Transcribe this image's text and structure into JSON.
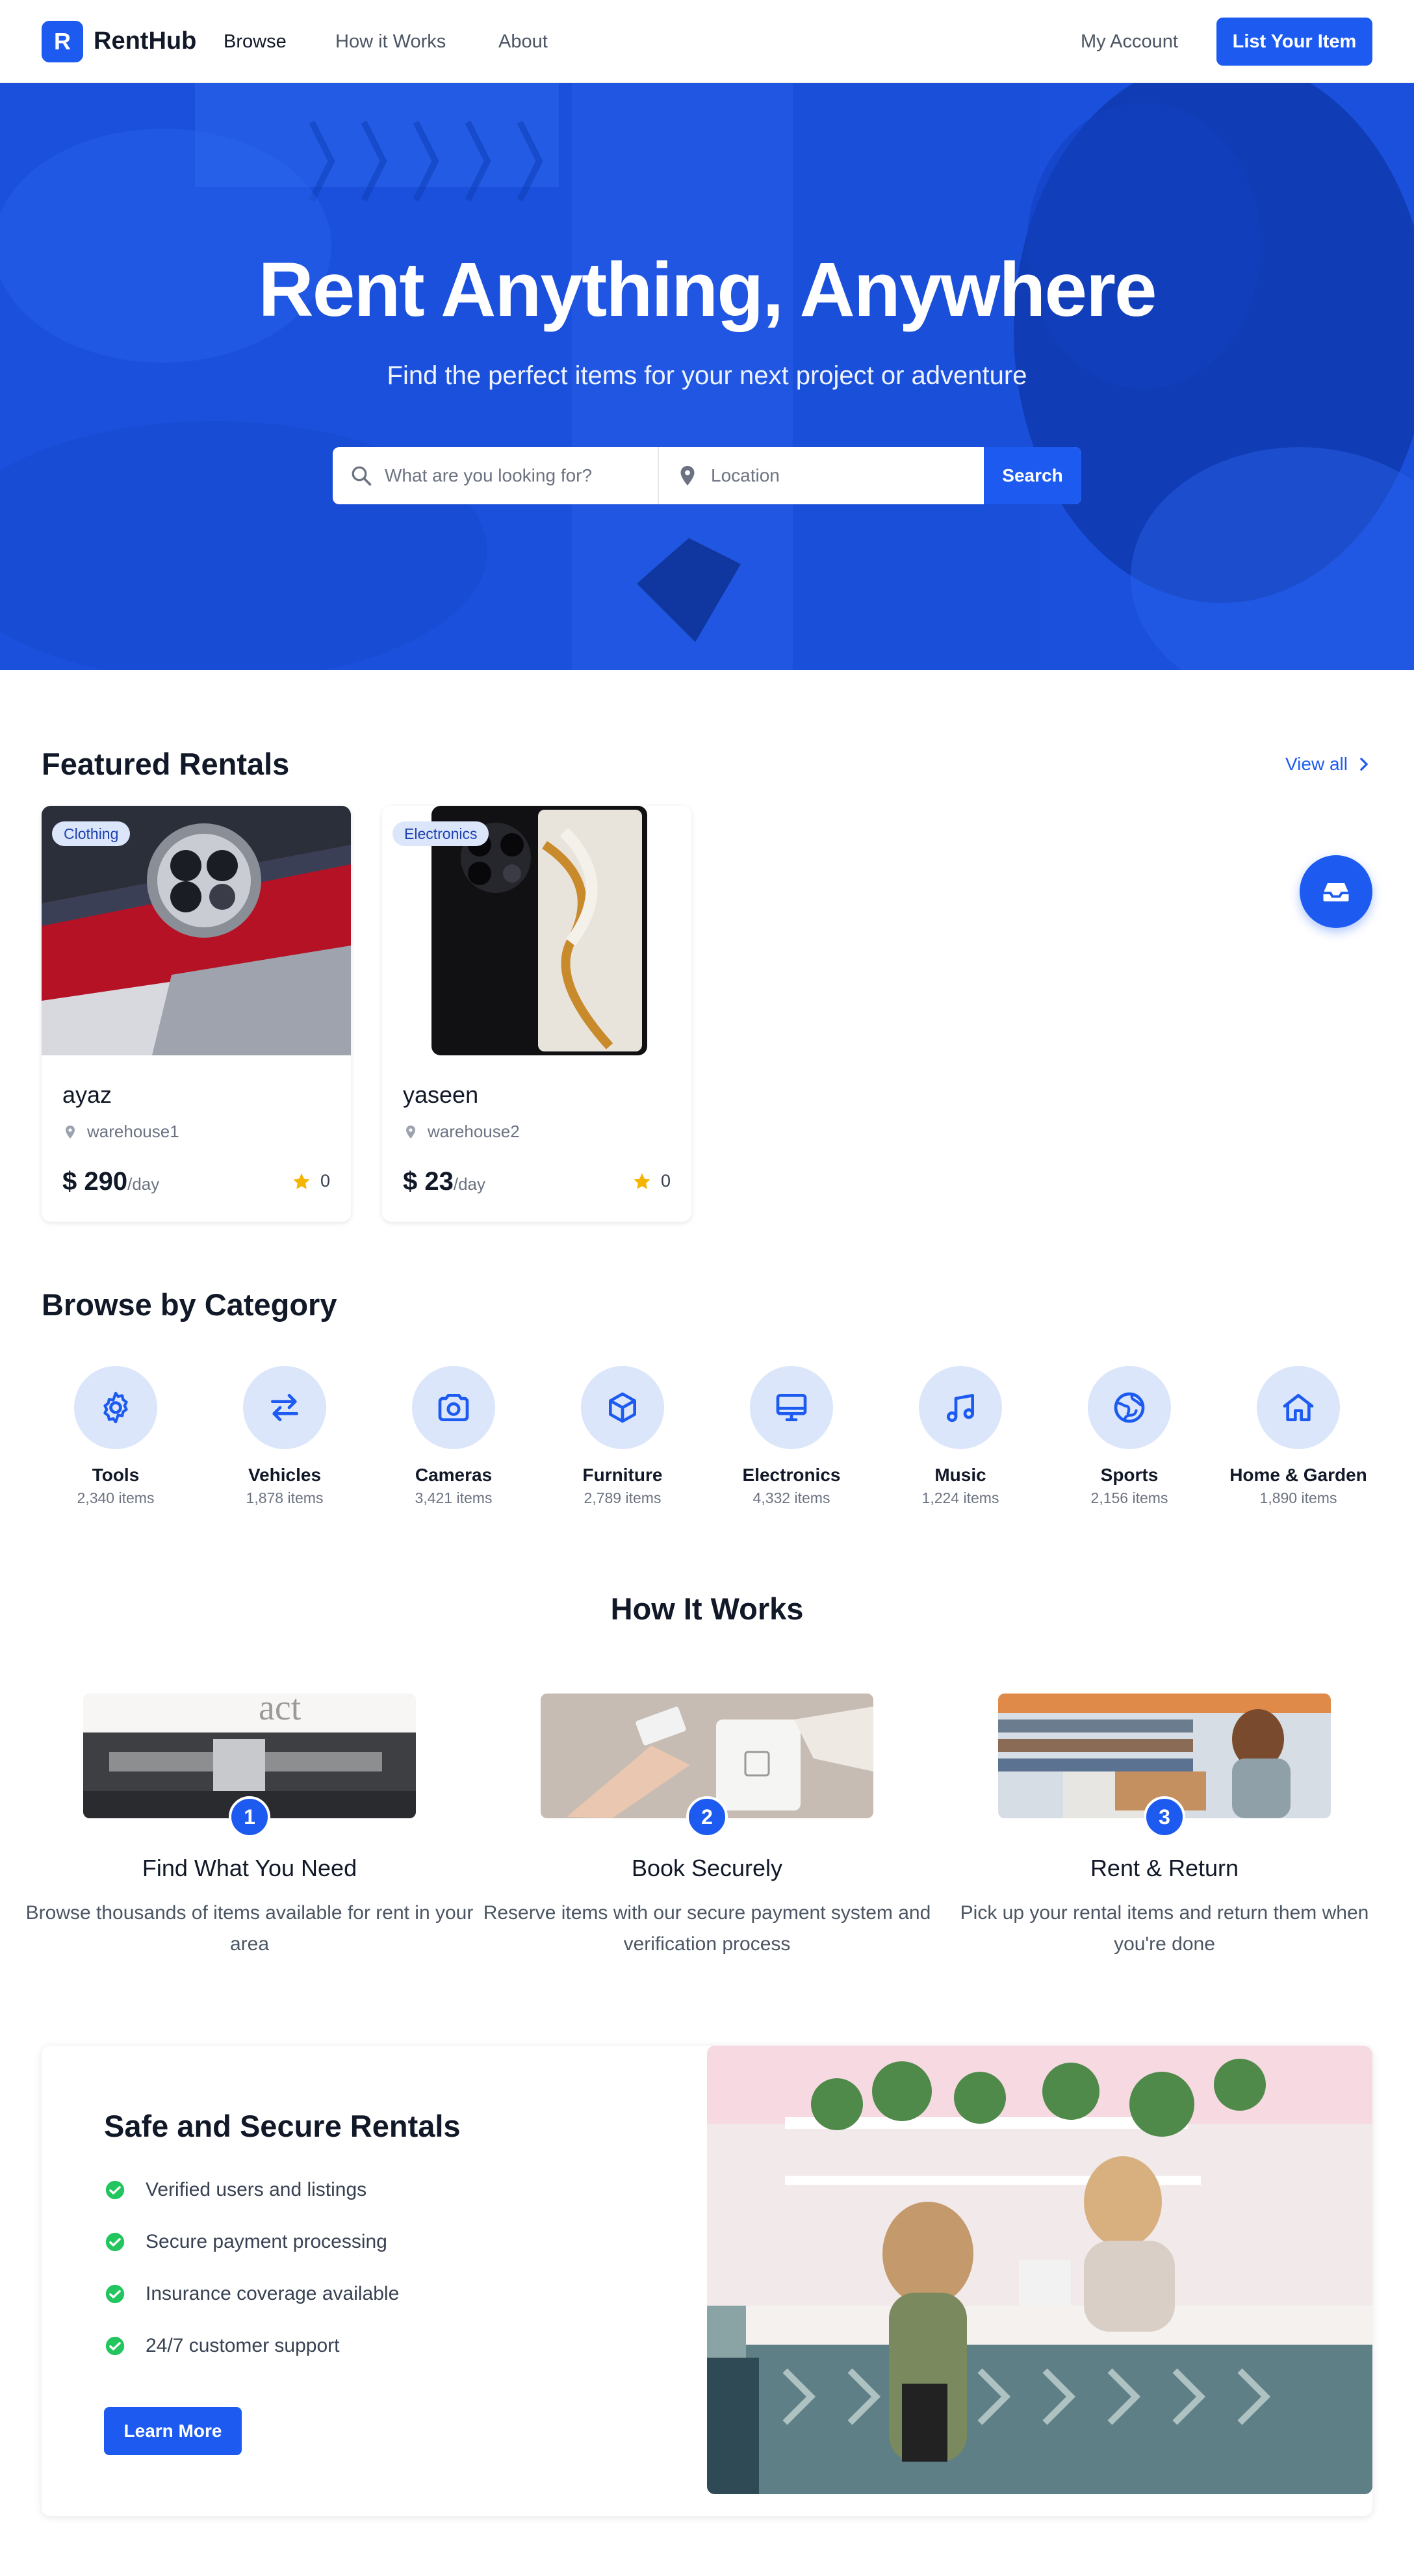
{
  "nav": {
    "logo_letter": "R",
    "brand": "RentHub",
    "links": [
      "Browse",
      "How it Works",
      "About"
    ],
    "account": "My Account",
    "cta": "List Your Item"
  },
  "hero": {
    "title": "Rent Anything, Anywhere",
    "subtitle": "Find the perfect items for your next project or adventure",
    "search_placeholder": "What are you looking for?",
    "location_placeholder": "Location",
    "search_button": "Search"
  },
  "featured": {
    "title": "Featured Rentals",
    "view_all": "View all",
    "items": [
      {
        "badge": "Clothing",
        "name": "ayaz",
        "location": "warehouse1",
        "currency": "$",
        "price": "290",
        "unit": "/day",
        "rating": "0"
      },
      {
        "badge": "Electronics",
        "name": "yaseen",
        "location": "warehouse2",
        "currency": "$",
        "price": "23",
        "unit": "/day",
        "rating": "0"
      }
    ]
  },
  "categories": {
    "title": "Browse by Category",
    "items": [
      {
        "name": "Tools",
        "count": "2,340 items",
        "icon": "gear-icon"
      },
      {
        "name": "Vehicles",
        "count": "1,878 items",
        "icon": "swap-arrows-icon"
      },
      {
        "name": "Cameras",
        "count": "3,421 items",
        "icon": "camera-icon"
      },
      {
        "name": "Furniture",
        "count": "2,789 items",
        "icon": "box-icon"
      },
      {
        "name": "Electronics",
        "count": "4,332 items",
        "icon": "monitor-icon"
      },
      {
        "name": "Music",
        "count": "1,224 items",
        "icon": "music-note-icon"
      },
      {
        "name": "Sports",
        "count": "2,156 items",
        "icon": "globe-ball-icon"
      },
      {
        "name": "Home & Garden",
        "count": "1,890 items",
        "icon": "home-icon"
      }
    ]
  },
  "how": {
    "title": "How It Works",
    "steps": [
      {
        "num": "1",
        "title": "Find What You Need",
        "desc": "Browse thousands of items available for rent in your area"
      },
      {
        "num": "2",
        "title": "Book Securely",
        "desc": "Reserve items with our secure payment system and verification process"
      },
      {
        "num": "3",
        "title": "Rent & Return",
        "desc": "Pick up your rental items and return them when you're done"
      }
    ]
  },
  "safe": {
    "title": "Safe and Secure Rentals",
    "items": [
      "Verified users and listings",
      "Secure payment processing",
      "Insurance coverage available",
      "24/7 customer support"
    ],
    "button": "Learn More"
  },
  "colors": {
    "accent": "#1d5bf0",
    "badge_bg": "#dbe6fb",
    "star": "#f5b400",
    "check": "#22c55e"
  }
}
